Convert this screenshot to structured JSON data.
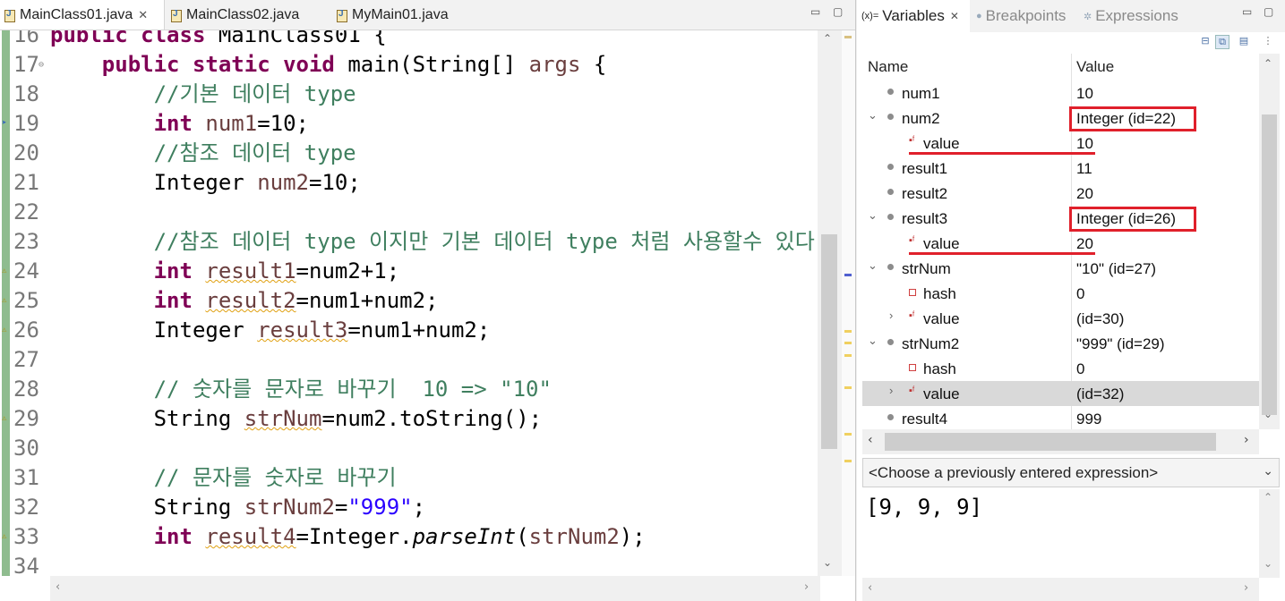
{
  "editor": {
    "tabs": [
      {
        "label": "MainClass01.java",
        "close": "✕"
      },
      {
        "label": "MainClass02.java"
      },
      {
        "label": "MyMain01.java"
      }
    ],
    "lines": [
      {
        "n": "16",
        "segs": [
          [
            "kw",
            "public "
          ],
          [
            "kw",
            "class "
          ],
          [
            "",
            "MainClass01 {"
          ]
        ]
      },
      {
        "n": "17",
        "segs": [
          [
            "",
            "    "
          ],
          [
            "kw",
            "public static void "
          ],
          [
            "",
            "main(String[] "
          ],
          [
            "var",
            "args"
          ],
          [
            "",
            " {"
          ]
        ]
      },
      {
        "n": "18",
        "segs": [
          [
            "",
            "        "
          ],
          [
            "cm",
            "//기본 데이터 type"
          ]
        ]
      },
      {
        "n": "19",
        "segs": [
          [
            "",
            "        "
          ],
          [
            "kw",
            "int "
          ],
          [
            "var",
            "num1"
          ],
          [
            "",
            "=10;"
          ]
        ]
      },
      {
        "n": "20",
        "segs": [
          [
            "",
            "        "
          ],
          [
            "cm",
            "//참조 데이터 type"
          ]
        ]
      },
      {
        "n": "21",
        "segs": [
          [
            "",
            "        Integer "
          ],
          [
            "var",
            "num2"
          ],
          [
            "",
            "=10;"
          ]
        ]
      },
      {
        "n": "22",
        "segs": []
      },
      {
        "n": "23",
        "segs": [
          [
            "",
            "        "
          ],
          [
            "cm",
            "//참조 데이터 type 이지만 기본 데이터 type 처럼 사용할수 있다."
          ]
        ]
      },
      {
        "n": "24",
        "segs": [
          [
            "",
            "        "
          ],
          [
            "kw",
            "int "
          ],
          [
            "var warn",
            "result1"
          ],
          [
            "",
            "=num2+1;"
          ]
        ]
      },
      {
        "n": "25",
        "segs": [
          [
            "",
            "        "
          ],
          [
            "kw",
            "int "
          ],
          [
            "var warn",
            "result2"
          ],
          [
            "",
            "=num1+num2;"
          ]
        ]
      },
      {
        "n": "26",
        "segs": [
          [
            "",
            "        Integer "
          ],
          [
            "var warn",
            "result3"
          ],
          [
            "",
            "=num1+num2;"
          ]
        ]
      },
      {
        "n": "27",
        "segs": []
      },
      {
        "n": "28",
        "segs": [
          [
            "",
            "        "
          ],
          [
            "cm",
            "// 숫자를 문자로 바꾸기  10 => \"10\""
          ]
        ]
      },
      {
        "n": "29",
        "segs": [
          [
            "",
            "        String "
          ],
          [
            "var warn",
            "strNum"
          ],
          [
            "",
            "=num2.toString();"
          ]
        ]
      },
      {
        "n": "30",
        "segs": []
      },
      {
        "n": "31",
        "segs": [
          [
            "",
            "        "
          ],
          [
            "cm",
            "// 문자를 숫자로 바꾸기"
          ]
        ]
      },
      {
        "n": "32",
        "segs": [
          [
            "",
            "        String "
          ],
          [
            "var",
            "strNum2"
          ],
          [
            "",
            "="
          ],
          [
            "st",
            "\"999\""
          ],
          [
            "",
            ";"
          ]
        ]
      },
      {
        "n": "33",
        "segs": [
          [
            "",
            "        "
          ],
          [
            "kw",
            "int "
          ],
          [
            "var warn",
            "result4"
          ],
          [
            "",
            "=Integer."
          ],
          [
            "it",
            "parseInt"
          ],
          [
            "",
            "("
          ],
          [
            "var",
            "strNum2"
          ],
          [
            "",
            ");"
          ]
        ]
      },
      {
        "n": "34",
        "segs": []
      }
    ]
  },
  "right": {
    "tabs": [
      {
        "icon": "(x)=",
        "label": "Variables",
        "close": "✕"
      },
      {
        "icon": "●",
        "label": "Breakpoints"
      },
      {
        "icon": "✲",
        "label": "Expressions"
      }
    ],
    "columns": {
      "name": "Name",
      "value": "Value"
    },
    "rows": [
      {
        "name": "num1",
        "value": "10",
        "indent": 0,
        "icon": "dot",
        "twisty": ""
      },
      {
        "name": "num2",
        "value": "Integer  (id=22)",
        "indent": 0,
        "icon": "dot",
        "twisty": "⌄",
        "highlight": "box"
      },
      {
        "name": "value",
        "value": "10",
        "indent": 1,
        "icon": "field",
        "twisty": "",
        "highlight": "line"
      },
      {
        "name": "result1",
        "value": "11",
        "indent": 0,
        "icon": "dot",
        "twisty": ""
      },
      {
        "name": "result2",
        "value": "20",
        "indent": 0,
        "icon": "dot",
        "twisty": ""
      },
      {
        "name": "result3",
        "value": "Integer  (id=26)",
        "indent": 0,
        "icon": "dot",
        "twisty": "⌄",
        "highlight": "box"
      },
      {
        "name": "value",
        "value": "20",
        "indent": 1,
        "icon": "field",
        "twisty": "",
        "highlight": "line"
      },
      {
        "name": "strNum",
        "value": "\"10\" (id=27)",
        "indent": 0,
        "icon": "dot",
        "twisty": "⌄"
      },
      {
        "name": "hash",
        "value": "0",
        "indent": 1,
        "icon": "square",
        "twisty": ""
      },
      {
        "name": "value",
        "value": "(id=30)",
        "indent": 1,
        "icon": "field",
        "twisty": "›"
      },
      {
        "name": "strNum2",
        "value": "\"999\" (id=29)",
        "indent": 0,
        "icon": "dot",
        "twisty": "⌄"
      },
      {
        "name": "hash",
        "value": "0",
        "indent": 1,
        "icon": "square",
        "twisty": ""
      },
      {
        "name": "value",
        "value": "(id=32)",
        "indent": 1,
        "icon": "field",
        "twisty": "›",
        "selected": true
      },
      {
        "name": "result4",
        "value": "999",
        "indent": 0,
        "icon": "dot",
        "twisty": ""
      }
    ],
    "expression_placeholder": "<Choose a previously entered expression>",
    "detail_text": "[9, 9, 9]"
  },
  "colors": {
    "keyword": "#7f0055",
    "comment": "#3f7f5f",
    "string": "#2a00ff",
    "highlight": "#e0202b"
  }
}
